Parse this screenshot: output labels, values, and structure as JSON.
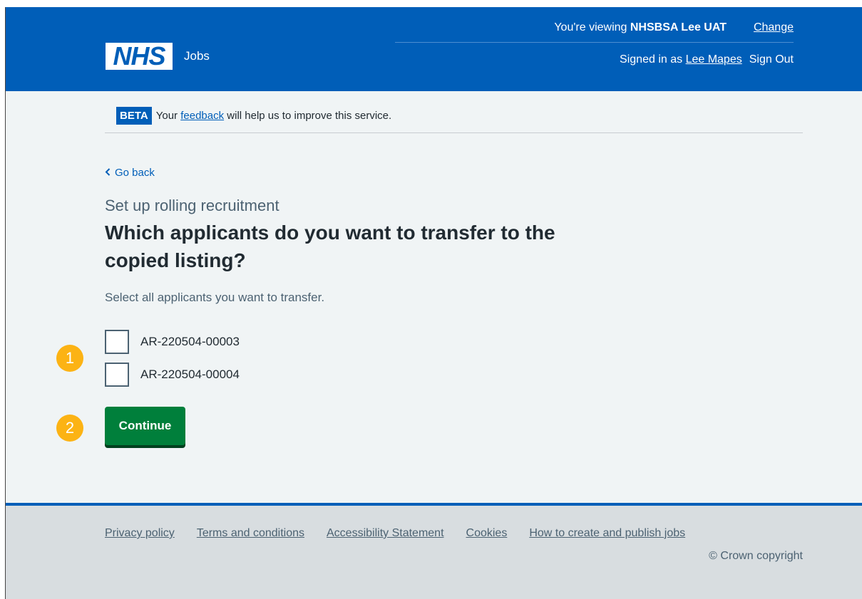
{
  "header": {
    "viewing_prefix": "You're viewing ",
    "organisation": "NHSBSA Lee UAT",
    "change_link": "Change",
    "logo_text": "NHS",
    "service_name": "Jobs",
    "signed_in_prefix": "Signed in as ",
    "user_name": "Lee Mapes",
    "sign_out": "Sign Out"
  },
  "beta_banner": {
    "tag": "BETA",
    "text_before": "Your ",
    "link": "feedback",
    "text_after": " will help us to improve this service."
  },
  "main": {
    "back_link": "Go back",
    "caption": "Set up rolling recruitment",
    "heading": "Which applicants do you want to transfer to the copied listing?",
    "hint": "Select all applicants you want to transfer.",
    "applicants": [
      {
        "label": "AR-220504-00003",
        "checked": false
      },
      {
        "label": "AR-220504-00004",
        "checked": false
      }
    ],
    "continue_button": "Continue"
  },
  "markers": [
    "1",
    "2"
  ],
  "footer": {
    "links": [
      "Privacy policy",
      "Terms and conditions",
      "Accessibility Statement",
      "Cookies",
      "How to create and publish jobs"
    ],
    "copyright": "© Crown copyright"
  },
  "colors": {
    "nhs_blue": "#005eb8",
    "button_green": "#007f3b",
    "marker_yellow": "#fcb314",
    "page_background": "#f0f4f5",
    "footer_background": "#d8dde0"
  }
}
